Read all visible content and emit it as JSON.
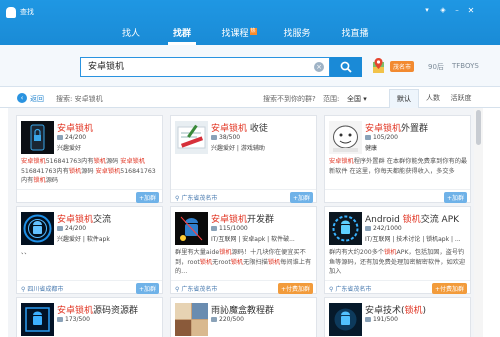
{
  "window": {
    "title": "查找",
    "controls": [
      "pin-icon",
      "skin-icon",
      "minimize-icon",
      "close-icon"
    ]
  },
  "nav": {
    "tabs": [
      {
        "label": "找人",
        "active": false
      },
      {
        "label": "找群",
        "active": true
      },
      {
        "label": "找课程",
        "active": false,
        "badge": "hot"
      },
      {
        "label": "找服务",
        "active": false
      },
      {
        "label": "找直播",
        "active": false
      }
    ]
  },
  "search": {
    "value": "安卓锁机",
    "clear_icon": "clear-icon",
    "button_icon": "search-icon",
    "city": "茂名市",
    "temperature": "90后",
    "hotword": "TFBOYS"
  },
  "filter": {
    "back_label": "返回",
    "crumb": "搜索: 安卓锁机",
    "not_found": "搜索不到你的群?",
    "range_label": "范围:",
    "range_value": "全国 ▾",
    "sort_tabs": [
      {
        "label": "默认",
        "active": true
      },
      {
        "label": "人数",
        "active": false
      },
      {
        "label": "活跃度",
        "active": false
      }
    ]
  },
  "groups": [
    {
      "name_hl": "安卓锁机",
      "name_rest": "",
      "members": "24/200",
      "tags": "兴趣爱好",
      "desc_parts": [
        {
          "t": "安卓锁机",
          "hl": true
        },
        {
          "t": "516841763内有",
          "hl": false
        },
        {
          "t": "锁机",
          "hl": true
        },
        {
          "t": "源码 ",
          "hl": false
        },
        {
          "t": "安卓锁机",
          "hl": true
        },
        {
          "t": "516841763内有",
          "hl": false
        },
        {
          "t": "锁机",
          "hl": true
        },
        {
          "t": "源码 ",
          "hl": false
        },
        {
          "t": "安卓锁机",
          "hl": true
        },
        {
          "t": "516841763内有",
          "hl": false
        },
        {
          "t": "锁机",
          "hl": true
        },
        {
          "t": "源码",
          "hl": false
        }
      ],
      "location": "",
      "join": "+加群",
      "paid": false,
      "thumb": "lock-phone"
    },
    {
      "name_hl": "安卓锁机",
      "name_rest": " 收徒",
      "members": "38/500",
      "tags": "兴趣爱好 | 游戏辅助",
      "desc_parts": [],
      "location": "广东省茂名市",
      "join": "+加群",
      "paid": false,
      "thumb": "pencil-book"
    },
    {
      "name_hl": "安卓锁机",
      "name_rest": "外置群",
      "members": "105/200",
      "tags": "健康",
      "desc_parts": [
        {
          "t": "安卓锁机",
          "hl": true
        },
        {
          "t": "程序外置群 在本群你能免费拿到你有的最新软件 在这里，你每天都能获得收入，多交多",
          "hl": false
        }
      ],
      "location": "",
      "join": "+加群",
      "paid": false,
      "thumb": "cartoon-face"
    },
    {
      "name_hl": "安卓锁机",
      "name_rest": "交流",
      "members": "24/200",
      "tags": "兴趣爱好 | 软件apk",
      "desc_parts": [
        {
          "t": "、、",
          "hl": false
        }
      ],
      "location": "四川省成都市",
      "join": "+加群",
      "paid": false,
      "thumb": "android-blue"
    },
    {
      "name_hl": "安卓锁机",
      "name_rest": "开发群",
      "members": "115/1000",
      "tags": "IT/互联网 | 安卓apk | 软件破...",
      "desc_parts": [
        {
          "t": "群里有大量aide",
          "hl": false
        },
        {
          "t": "锁机",
          "hl": true
        },
        {
          "t": "源码！十几块你在便宜买不到，root",
          "hl": false
        },
        {
          "t": "锁机",
          "hl": true
        },
        {
          "t": "无root",
          "hl": false
        },
        {
          "t": "锁机",
          "hl": true
        },
        {
          "t": "无限扫描",
          "hl": false
        },
        {
          "t": "锁机",
          "hl": true
        },
        {
          "t": "每间谁上有的…",
          "hl": false
        }
      ],
      "location": "广东省茂名市",
      "join": "+付费加群",
      "paid": true,
      "thumb": "android-dark"
    },
    {
      "name_hl": "",
      "name_pre": "Android ",
      "name_hl2": "锁机",
      "name_rest": "交流 APK",
      "members": "242/1000",
      "tags": "IT/互联网 | 技术讨论 | 锁机apk | ...",
      "desc_parts": [
        {
          "t": "群内有大约200多个",
          "hl": false
        },
        {
          "t": "锁机",
          "hl": true
        },
        {
          "t": "APK，包括加固，盗号钓鱼等源码，还有加免费处理加密解密软件，如欢迎加入",
          "hl": false
        }
      ],
      "location": "广东省茂名市",
      "join": "+付费加群",
      "paid": true,
      "thumb": "android-grid"
    },
    {
      "name_hl": "安卓锁机",
      "name_rest": "源码资源群",
      "members": "173/500",
      "tags": "",
      "desc_parts": [],
      "location": "",
      "join": "",
      "paid": false,
      "thumb": "android-frame"
    },
    {
      "name_hl": "",
      "name_rest": "雨訫魔盒教程群",
      "members": "220/500",
      "tags": "",
      "desc_parts": [],
      "location": "",
      "join": "",
      "paid": false,
      "thumb": "mixed-photo"
    },
    {
      "name_hl": "",
      "name_pre": "安卓技术(",
      "name_hl2": "锁机",
      "name_rest": ")",
      "members": "191/500",
      "tags": "",
      "desc_parts": [],
      "location": "",
      "join": "",
      "paid": false,
      "thumb": "android-dark2"
    }
  ],
  "colors": {
    "accent": "#1a8bd6",
    "highlight": "#e0301e",
    "paid": "#f29b3b"
  }
}
